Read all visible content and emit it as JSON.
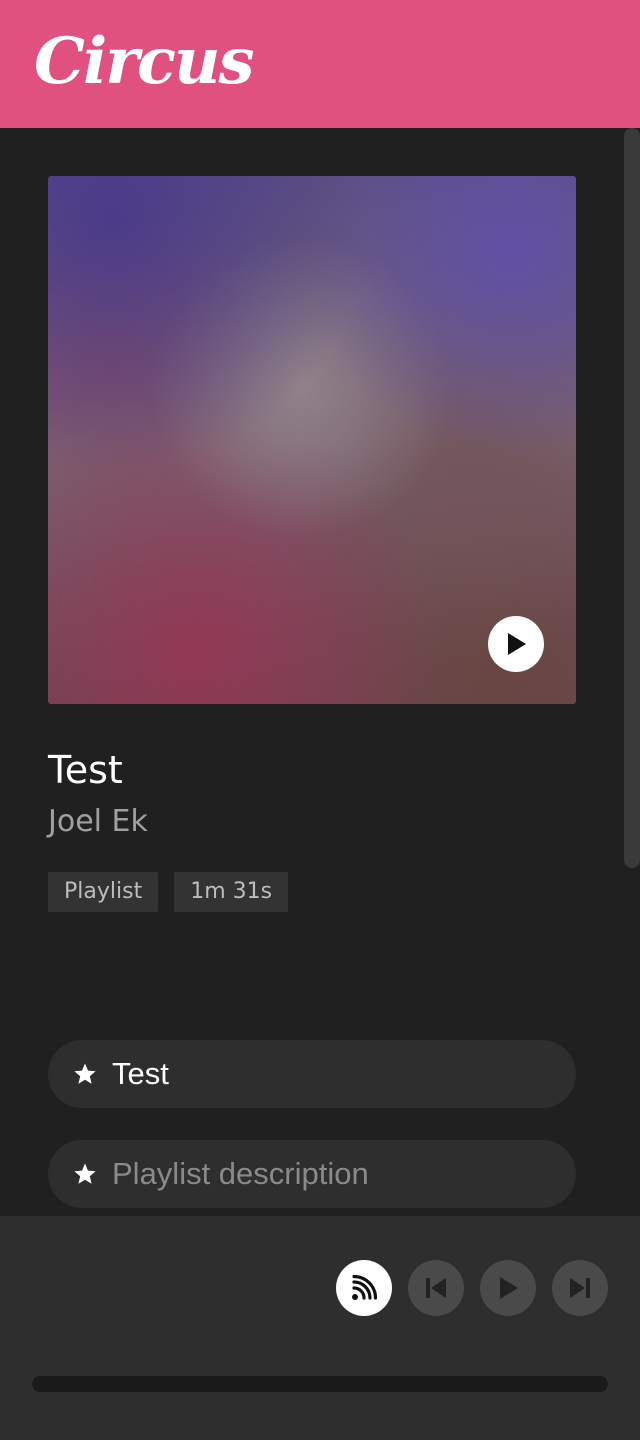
{
  "app": {
    "name": "Circus",
    "accent_color": "#e05180"
  },
  "playlist": {
    "title": "Test",
    "author": "Joel Ek",
    "type_badge": "Playlist",
    "duration_badge": "1m 31s",
    "artwork_play_icon": "play-icon"
  },
  "form": {
    "title_value": "Test",
    "title_icon": "star-icon",
    "description_value": "",
    "description_placeholder": "Playlist description",
    "description_icon": "star-icon"
  },
  "player": {
    "cast_icon": "cast-icon",
    "previous_icon": "skip-previous-icon",
    "play_icon": "play-icon",
    "next_icon": "skip-next-icon",
    "progress": 0
  }
}
